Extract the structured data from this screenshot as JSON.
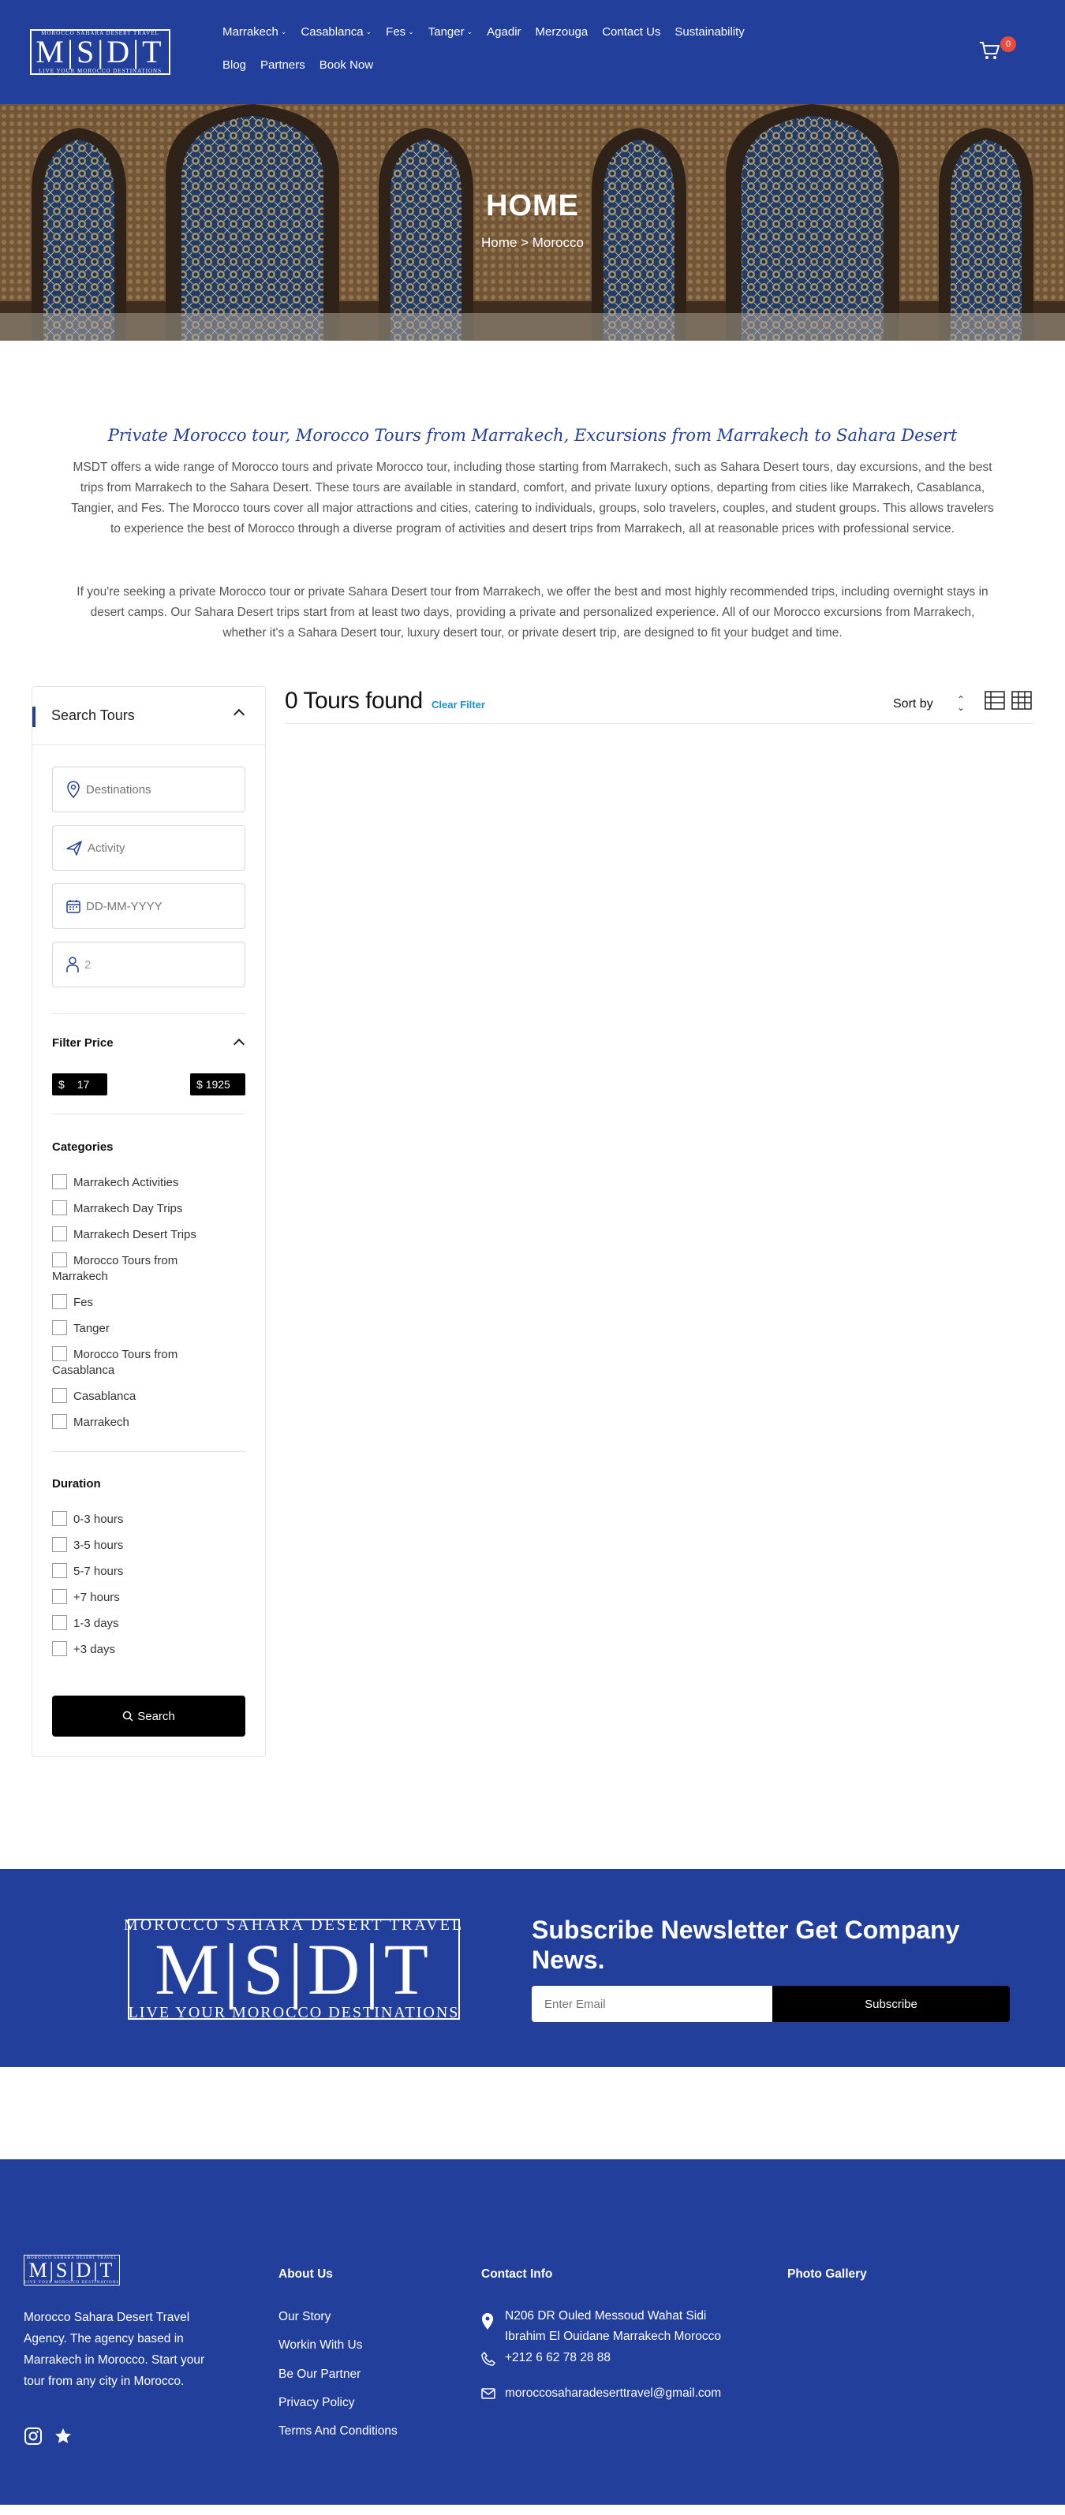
{
  "header": {
    "logo": {
      "top_text": "MOROCCO SAHARA DESERT TRAVEL",
      "main_text": "M|S|D|T",
      "bottom_text": "LIVE YOUR MOROCCO DESTINATIONS"
    },
    "nav_row1": [
      {
        "label": "Marrakech",
        "dropdown": true
      },
      {
        "label": "Casablanca",
        "dropdown": true
      },
      {
        "label": "Fes",
        "dropdown": true
      },
      {
        "label": "Tanger",
        "dropdown": true
      },
      {
        "label": "Agadir",
        "dropdown": false
      },
      {
        "label": "Merzouga",
        "dropdown": false
      },
      {
        "label": "Contact Us",
        "dropdown": false
      },
      {
        "label": "Sustainability",
        "dropdown": false
      }
    ],
    "nav_row2": [
      {
        "label": "Blog"
      },
      {
        "label": "Partners"
      },
      {
        "label": "Book Now"
      }
    ],
    "cart_count": "0",
    "colors": {
      "brand": "#223f9c",
      "badge": "#e74c3c"
    }
  },
  "hero": {
    "title": "HOME",
    "breadcrumb": "Home > Morocco"
  },
  "intro": {
    "heading": "Private Morocco tour, Morocco Tours from Marrakech, Excursions from Marrakech to Sahara Desert",
    "paragraph1": "MSDT offers a wide range of Morocco tours and private Morocco tour, including those starting from Marrakech, such as Sahara Desert tours, day excursions, and the best trips from Marrakech to the Sahara Desert. These tours are available in standard, comfort, and private luxury options, departing from cities like Marrakech, Casablanca, Tangier, and Fes. The Morocco tours cover all major attractions and cities, catering to individuals, groups, solo travelers, couples, and student groups. This allows travelers to experience the best of Morocco through a diverse program of activities and desert trips from Marrakech, all at reasonable prices with professional service.",
    "paragraph2": "If you're seeking a private Morocco tour or private Sahara Desert tour from Marrakech, we offer the best and most highly recommended trips, including overnight stays in desert camps. Our Sahara Desert trips start from at least two days, providing a private and personalized experience. All of our Morocco excursions from Marrakech, whether it's a Sahara Desert tour, luxury desert tour, or private desert trip, are designed to fit your budget and time."
  },
  "sidebar": {
    "title": "Search Tours",
    "destinations_placeholder": "Destinations",
    "activity_placeholder": "Activity",
    "date_placeholder": "DD-MM-YYYY",
    "guests_value": "2",
    "filter_price_label": "Filter Price",
    "price_min": "17",
    "price_max": "1925",
    "currency": "$",
    "categories_label": "Categories",
    "categories": [
      "Marrakech Activities",
      "Marrakech Day Trips",
      "Marrakech Desert Trips",
      "Morocco Tours from Marrakech",
      "Fes",
      "Tanger",
      "Morocco Tours from Casablanca",
      "Casablanca",
      "Marrakech"
    ],
    "duration_label": "Duration",
    "durations": [
      "0-3 hours",
      "3-5 hours",
      "5-7 hours",
      "+7 hours",
      "1-3 days",
      "+3 days"
    ],
    "search_button": "Search"
  },
  "results": {
    "count_text": "0 Tours found",
    "clear_filter": "Clear Filter",
    "sort_label": "Sort by"
  },
  "newsletter": {
    "logo": {
      "top_text": "MOROCCO  SAHARA  DESERT  TRAVEL",
      "main_text": "M|S|D|T",
      "bottom_text": "LIVE YOUR MOROCCO DESTINATIONS"
    },
    "title": "Subscribe Newsletter Get Company News.",
    "email_placeholder": "Enter Email",
    "subscribe_button": "Subscribe"
  },
  "footer": {
    "logo": {
      "top_text": "MOROCCO SAHARA DESERT TRAVEL",
      "main_text": "M|S|D|T",
      "bottom_text": "LIVE YOUR MOROCCO DESTINATIONS"
    },
    "description": "Morocco Sahara Desert Travel Agency. The agency based in Marrakech in Morocco. Start your tour from any city in Morocco.",
    "about_title": "About Us",
    "about_links": [
      "Our Story",
      "Workin With Us",
      "Be Our Partner",
      "Privacy Policy",
      "Terms And Conditions"
    ],
    "contact_title": "Contact Info",
    "address_line1": "N206 DR Ouled Messoud Wahat Sidi",
    "address_line2": "Ibrahim El Ouidane Marrakech Morocco",
    "phone": "+212 6 62 78 28 88",
    "email": "moroccosaharadeserttravel@gmail.com",
    "gallery_title": "Photo Gallery"
  }
}
